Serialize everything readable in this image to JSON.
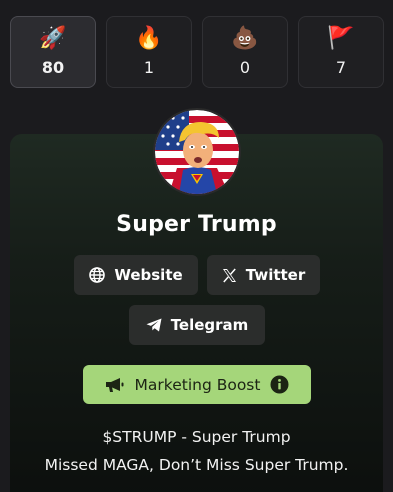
{
  "reactions": [
    {
      "emoji": "🚀",
      "icon": "rocket-icon",
      "count": "80",
      "active": true
    },
    {
      "emoji": "🔥",
      "icon": "fire-icon",
      "count": "1",
      "active": false
    },
    {
      "emoji": "💩",
      "icon": "poop-icon",
      "count": "0",
      "active": false
    },
    {
      "emoji": "🚩",
      "icon": "red-flag-icon",
      "count": "7",
      "active": false
    }
  ],
  "token": {
    "name": "Super Trump",
    "description_line1": "$STRUMP - Super Trump",
    "description_line2": "Missed MAGA, Don’t Miss Super Trump."
  },
  "links": {
    "website_label": "Website",
    "twitter_label": "Twitter",
    "telegram_label": "Telegram"
  },
  "boost": {
    "label": "Marketing Boost",
    "icon": "megaphone-icon",
    "info_icon": "info-icon"
  },
  "colors": {
    "background": "#1b1b1e",
    "boost_accent": "#a5d67a",
    "link_button": "#2b2d2c"
  }
}
